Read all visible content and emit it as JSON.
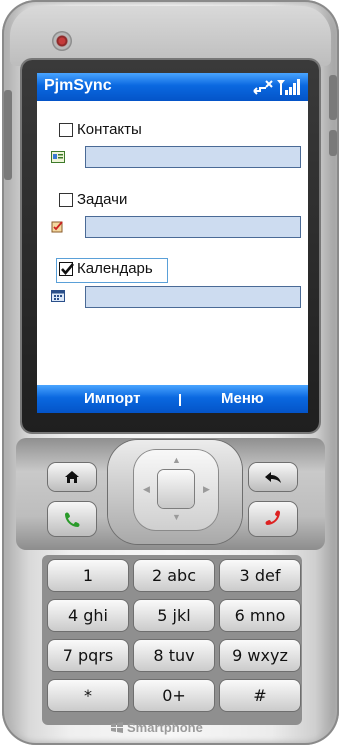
{
  "app": {
    "title": "PjmSync"
  },
  "items": [
    {
      "label": "Контакты",
      "checked": false,
      "icon": "contacts-icon",
      "value": ""
    },
    {
      "label": "Задачи",
      "checked": false,
      "icon": "tasks-icon",
      "value": ""
    },
    {
      "label": "Календарь",
      "checked": true,
      "icon": "calendar-icon",
      "value": ""
    }
  ],
  "softkeys": {
    "left": "Импорт",
    "right": "Меню"
  },
  "keypad": [
    [
      "1",
      "2 abc",
      "3 def"
    ],
    [
      "4 ghi",
      "5 jkl",
      "6 mno"
    ],
    [
      "7 pqrs",
      "8 tuv",
      "9 wxyz"
    ],
    [
      "*",
      "0+",
      "#"
    ]
  ],
  "brand": "Smartphone",
  "colors": {
    "titlebar": "#0a68e0",
    "field": "#cddcf0",
    "focus": "#5aa0d8"
  }
}
